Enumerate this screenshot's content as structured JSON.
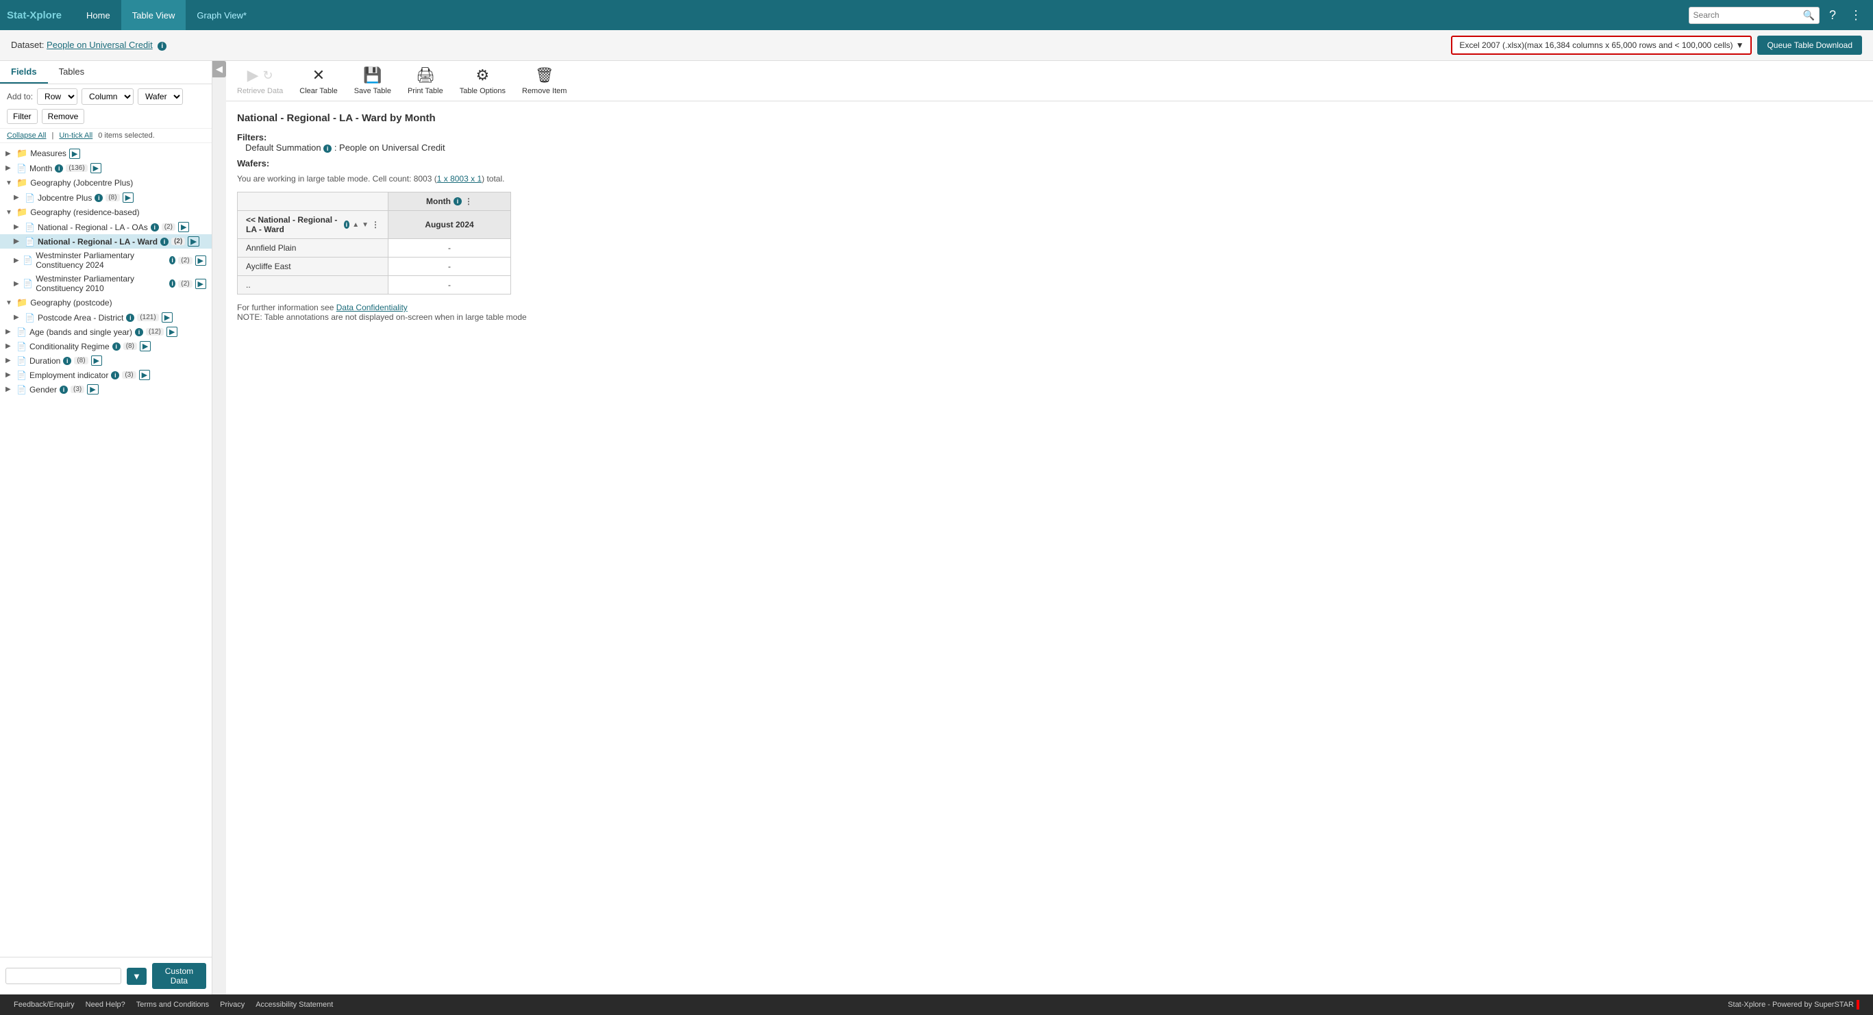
{
  "app": {
    "logo_prefix": "Stat-",
    "logo_suffix": "Xplore",
    "nav_items": [
      "Home",
      "Table View",
      "Graph View*"
    ],
    "active_nav": "Table View",
    "search_placeholder": "Search",
    "help_icon": "?",
    "menu_icon": "⋮"
  },
  "dataset_bar": {
    "label": "Dataset:",
    "dataset_name": "People on Universal Credit",
    "format_label": "Excel 2007 (.xlsx)(max 16,384 columns x 65,000 rows and < 100,000 cells)",
    "queue_btn": "Queue Table Download"
  },
  "sidebar": {
    "tabs": [
      "Fields",
      "Tables"
    ],
    "active_tab": "Fields",
    "add_label": "Add to:",
    "add_options": [
      "Row",
      "Column",
      "Wafer"
    ],
    "filter_btn": "Filter",
    "remove_btn": "Remove",
    "collapse_all": "Collapse All",
    "untick_all": "Un-tick All",
    "selected_count": "0 items selected.",
    "tree": [
      {
        "id": "measures",
        "label": "Measures",
        "level": 0,
        "type": "folder",
        "expanded": false
      },
      {
        "id": "month",
        "label": "Month",
        "level": 0,
        "type": "doc",
        "badge": "136",
        "has_info": true,
        "has_arrow": true
      },
      {
        "id": "geo-jobcentre",
        "label": "Geography (Jobcentre Plus)",
        "level": 0,
        "type": "folder",
        "expanded": true
      },
      {
        "id": "jobcentre-plus",
        "label": "Jobcentre Plus",
        "level": 1,
        "type": "doc",
        "badge": "8",
        "has_info": true,
        "has_arrow": true
      },
      {
        "id": "geo-residence",
        "label": "Geography (residence-based)",
        "level": 0,
        "type": "folder",
        "expanded": true
      },
      {
        "id": "nat-reg-la-oas",
        "label": "National - Regional - LA - OAs",
        "level": 1,
        "type": "doc",
        "badge": "2",
        "has_info": true,
        "has_arrow": true
      },
      {
        "id": "nat-reg-la-ward",
        "label": "National - Regional - LA - Ward",
        "level": 1,
        "type": "doc",
        "badge": "2",
        "has_info": true,
        "has_arrow": true,
        "selected": true
      },
      {
        "id": "westminster-2024",
        "label": "Westminster Parliamentary Constituency 2024",
        "level": 1,
        "type": "doc",
        "badge": "2",
        "has_info": true,
        "has_arrow": true
      },
      {
        "id": "westminster-2010",
        "label": "Westminster Parliamentary Constituency 2010",
        "level": 1,
        "type": "doc",
        "badge": "2",
        "has_info": true,
        "has_arrow": true
      },
      {
        "id": "geo-postcode",
        "label": "Geography (postcode)",
        "level": 0,
        "type": "folder",
        "expanded": true
      },
      {
        "id": "postcode-area",
        "label": "Postcode Area - District",
        "level": 1,
        "type": "doc",
        "badge": "121",
        "has_info": true,
        "has_arrow": true
      },
      {
        "id": "age",
        "label": "Age (bands and single year)",
        "level": 0,
        "type": "doc",
        "badge": "12",
        "has_info": true,
        "has_arrow": true
      },
      {
        "id": "conditionality",
        "label": "Conditionality Regime",
        "level": 0,
        "type": "doc",
        "badge": "8",
        "has_info": true,
        "has_arrow": true
      },
      {
        "id": "duration",
        "label": "Duration",
        "level": 0,
        "type": "doc",
        "badge": "8",
        "has_arrow": true
      },
      {
        "id": "employment",
        "label": "Employment indicator",
        "level": 0,
        "type": "doc",
        "badge": "3",
        "has_info": true,
        "has_arrow": true
      },
      {
        "id": "gender",
        "label": "Gender",
        "level": 0,
        "type": "doc",
        "badge": "3",
        "has_info": true,
        "has_arrow": true
      }
    ],
    "custom_data_btn": "Custom Data",
    "filter_icon": "▼"
  },
  "toolbar": {
    "retrieve_data": "Retrieve Data",
    "clear_table": "Clear Table",
    "save_table": "Save Table",
    "print_table": "Print Table",
    "table_options": "Table Options",
    "remove_item": "Remove Item"
  },
  "table": {
    "title": "National - Regional - LA - Ward by Month",
    "filters_label": "Filters:",
    "filter_detail": "Default Summation",
    "filter_value": ": People on Universal Credit",
    "wafers_label": "Wafers:",
    "large_table_note": "You are working in large table mode. Cell count: 8003 (",
    "cell_link": "1 x 8003 x 1",
    "cell_suffix": ") total.",
    "col_header": "Month",
    "col_subheader": "August 2024",
    "row_header": "<< National - Regional - LA - Ward",
    "rows": [
      {
        "label": "Annfield Plain",
        "value": "-"
      },
      {
        "label": "Aycliffe East",
        "value": "-"
      },
      {
        "label": "..",
        "value": "-"
      }
    ],
    "footnote_prefix": "For further information see ",
    "footnote_link": "Data Confidentiality",
    "footnote_note": "NOTE: Table annotations are not displayed on-screen when in large table mode"
  },
  "footer": {
    "links": [
      "Feedback/Enquiry",
      "Need Help?",
      "Terms and Conditions",
      "Privacy",
      "Accessibility Statement"
    ],
    "brand": "Stat-Xplore - Powered by SuperSTAR"
  }
}
